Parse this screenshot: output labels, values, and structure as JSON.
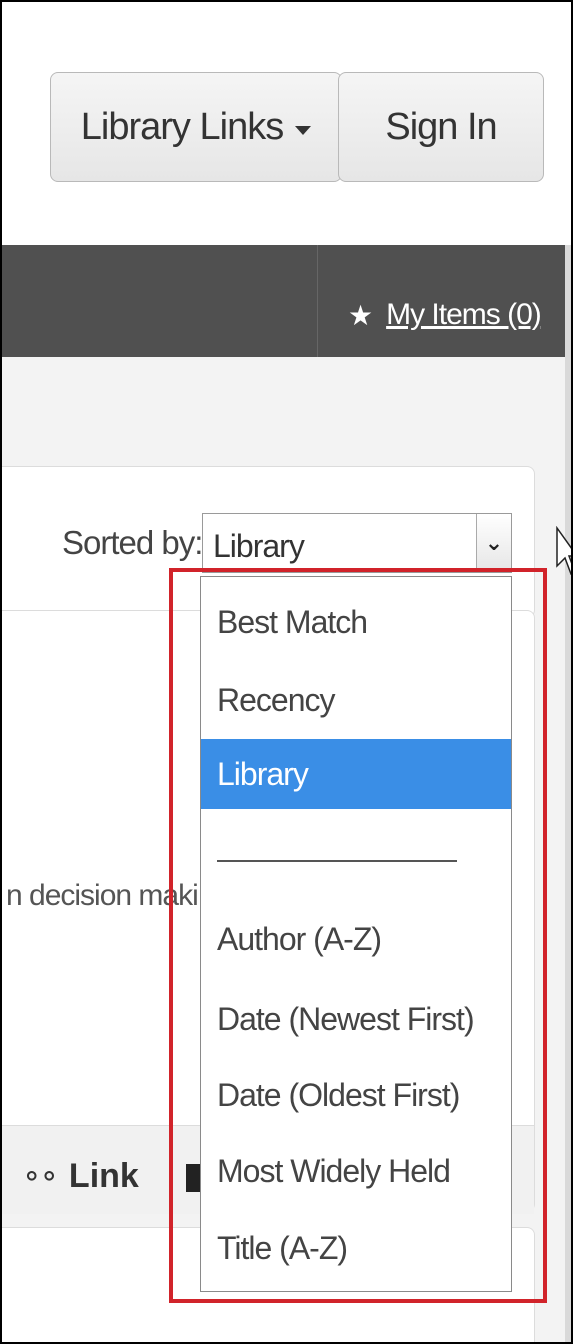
{
  "header": {
    "library_links_label": "Library Links",
    "sign_in_label": "Sign In"
  },
  "navbar": {
    "my_items_label": "My Items (0)",
    "my_items_icon": "star-icon"
  },
  "sort": {
    "label": "Sorted by:",
    "selected_value": "Library",
    "options": [
      {
        "label": "Best Match",
        "selected": false
      },
      {
        "label": "Recency",
        "selected": false
      },
      {
        "label": "Library",
        "selected": true
      },
      {
        "label": "Author (A-Z)",
        "selected": false
      },
      {
        "label": "Date (Newest First)",
        "selected": false
      },
      {
        "label": "Date (Oldest First)",
        "selected": false
      },
      {
        "label": "Most Widely Held",
        "selected": false
      },
      {
        "label": "Title (A-Z)",
        "selected": false
      }
    ]
  },
  "result": {
    "snippet_text": "n decision maki",
    "link_action_label": "Link"
  },
  "colors": {
    "navbar": "#505050",
    "selected_option": "#3a8ee6",
    "highlight_border": "#d1232a"
  }
}
